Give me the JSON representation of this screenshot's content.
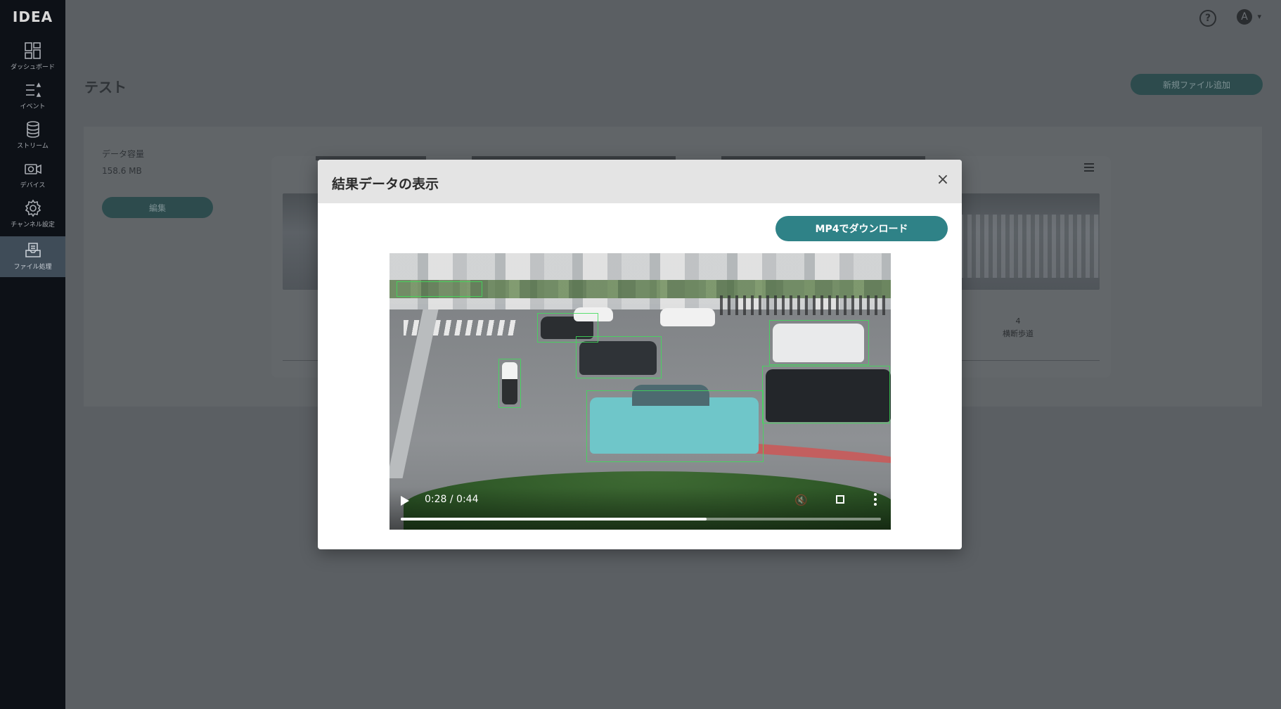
{
  "app": {
    "logo": "IDEA"
  },
  "sidebar": {
    "items": [
      {
        "label": "ダッシュボード",
        "icon": "dashboard-icon"
      },
      {
        "label": "イベント",
        "icon": "event-list-icon"
      },
      {
        "label": "ストリーム",
        "icon": "database-icon"
      },
      {
        "label": "デバイス",
        "icon": "camera-icon"
      },
      {
        "label": "チャンネル設定",
        "icon": "gear-icon"
      },
      {
        "label": "ファイル処理",
        "icon": "file-tray-icon",
        "active": true
      }
    ]
  },
  "header": {
    "help": "?",
    "user_initial": "A"
  },
  "page": {
    "title": "テスト",
    "add_file_label": "新規ファイル追加",
    "capacity_label": "データ容量",
    "capacity_value": "158.6 MB",
    "edit_label": "編集",
    "cross_count": "4",
    "cross_label": "横断歩道"
  },
  "modal": {
    "title": "結果データの表示",
    "close": "×",
    "download_label": "MP4でダウンロード",
    "video": {
      "current_time": "0:28",
      "duration": "0:44",
      "time_display": "0:28 / 0:44",
      "progress": 0.637
    }
  },
  "colors": {
    "sidebar_bg": "#0d1117",
    "accent": "#2f8287",
    "overlay_bg": "#5b5f63",
    "detection_box": "#3fdc5a"
  }
}
